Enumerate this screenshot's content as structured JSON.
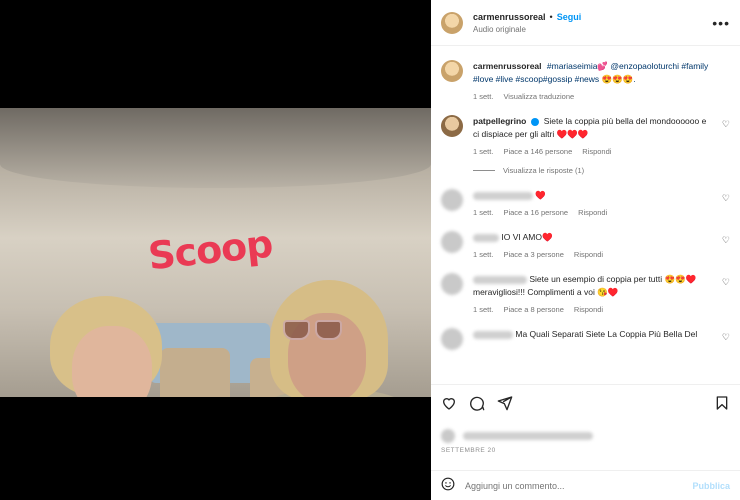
{
  "video": {
    "overlay_text": "Scoop",
    "mute_icon": "speaker-muted-icon"
  },
  "header": {
    "username": "carmenrussoreal",
    "separator": "•",
    "follow_label": "Segui",
    "audio_label": "Audio originale",
    "more_icon": "more-horizontal-icon"
  },
  "caption": {
    "username": "carmenrussoreal",
    "text_plain": "#mariaseimia💕 @enzopaoloturchi #family #love #live #scoop#gossip #news 😍😍😍.",
    "time": "1 sett.",
    "translate_label": "Visualizza traduzione"
  },
  "comments": [
    {
      "username": "patpellegrino",
      "text": "Siete la coppia più bella del mondoooooo e ci dispiace per gli altri ♥️♥️♥️",
      "time": "1 sett.",
      "likes": "Piace a 146 persone",
      "reply_label": "Rispondi",
      "view_replies": "Visualizza le risposte (1)"
    },
    {
      "username": "",
      "text": "♥️",
      "time": "1 sett.",
      "likes": "Piace a 16 persone",
      "reply_label": "Rispondi"
    },
    {
      "username": "",
      "text": "IO VI AMO♥️",
      "time": "1 sett.",
      "likes": "Piace a 3 persone",
      "reply_label": "Rispondi"
    },
    {
      "username": "",
      "text": "Siete un esempio di coppia per tutti 😍😍♥️ meravigliosi!!! Complimenti a voi 😘♥️",
      "time": "1 sett.",
      "likes": "Piace a 8 persone",
      "reply_label": "Rispondi"
    },
    {
      "username": "",
      "text": "Ma Quali Separati Siete La Coppia Più Bella Del",
      "time": "",
      "likes": "",
      "reply_label": ""
    }
  ],
  "actions": {
    "like_icon": "heart-icon",
    "comment_icon": "comment-icon",
    "share_icon": "send-icon",
    "save_icon": "bookmark-icon",
    "date": "SETTEMBRE 20"
  },
  "add_comment": {
    "emoji_icon": "emoji-icon",
    "placeholder": "Aggiungi un commento...",
    "publish_label": "Pubblica"
  },
  "colors": {
    "accent": "#0095f6",
    "publish_disabled": "#b2dffc",
    "overlay_text": "#ea3a54"
  }
}
